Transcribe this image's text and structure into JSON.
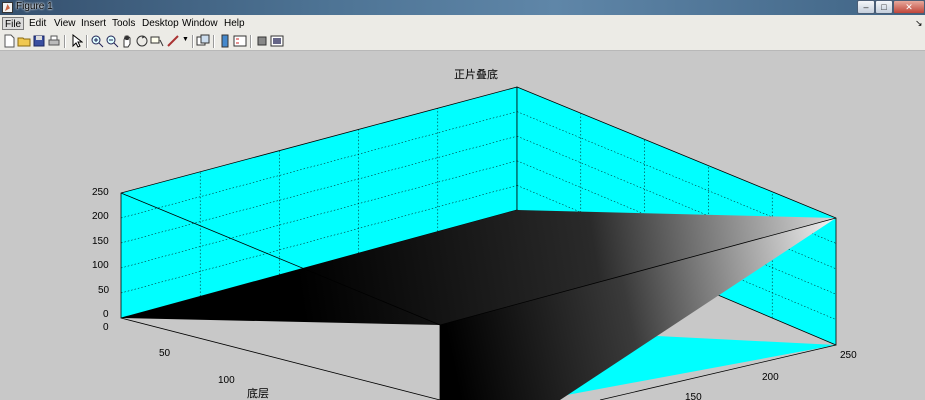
{
  "window": {
    "title": "Figure 1",
    "minimize_glyph": "‒",
    "maximize_glyph": "□",
    "close_glyph": "✕"
  },
  "menu": {
    "items": [
      {
        "label": "File"
      },
      {
        "label": "Edit"
      },
      {
        "label": "View"
      },
      {
        "label": "Insert"
      },
      {
        "label": "Tools"
      },
      {
        "label": "Desktop"
      },
      {
        "label": "Window"
      },
      {
        "label": "Help"
      }
    ],
    "active": "File"
  },
  "toolbar": {
    "icons": [
      "new-figure-icon",
      "open-file-icon",
      "save-figure-icon",
      "print-figure-icon",
      "edit-plot-arrow-icon",
      "zoom-in-icon",
      "zoom-out-icon",
      "pan-hand-icon",
      "rotate-3d-icon",
      "data-cursor-icon",
      "brush-icon",
      "link-plot-icon",
      "colorbar-icon",
      "legend-icon",
      "hide-plot-tools-icon",
      "show-plot-tools-icon"
    ]
  },
  "colors": {
    "wall": "#00ffff",
    "background": "#c8c8c8",
    "title_bar": "#4d7394"
  },
  "chart_data": {
    "type": "surface",
    "title": "正片叠底",
    "xlabel": "底层",
    "ylabel": "",
    "zlabel": "",
    "z_ticks": [
      "0",
      "50",
      "100",
      "150",
      "200",
      "250"
    ],
    "x_ticks_visible": [
      "0",
      "50",
      "100"
    ],
    "y_ticks_visible": [
      "150",
      "200",
      "250"
    ],
    "xlim": [
      0,
      255
    ],
    "ylim": [
      0,
      255
    ],
    "zlim": [
      0,
      255
    ],
    "grid": true,
    "colormap": "gray",
    "function": "multiply blend: z = x*y/255"
  }
}
